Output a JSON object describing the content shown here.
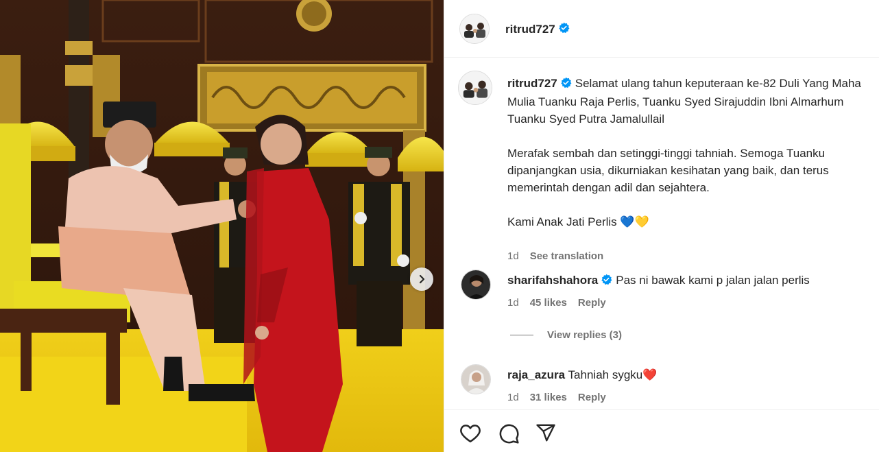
{
  "post": {
    "author": "ritrud727",
    "caption": {
      "username": "ritrud727",
      "paragraph1": "Selamat ulang tahun keputeraan ke-82 Duli Yang Maha Mulia Tuanku Raja Perlis, Tuanku Syed Sirajuddin Ibni Almarhum Tuanku Syed Putra Jamalullail",
      "paragraph2": "Merafak sembah dan setinggi-tinggi tahniah. Semoga Tuanku dipanjangkan usia, dikurniakan kesihatan yang baik, dan terus memerintah dengan adil dan sejahtera.",
      "paragraph3": "Kami Anak Jati Perlis 💙💛",
      "time": "1d",
      "see_translation": "See translation"
    },
    "comments": [
      {
        "username": "sharifahshahora",
        "text": "Pas ni bawak kami p jalan jalan perlis",
        "time": "1d",
        "likes": "45 likes",
        "reply": "Reply",
        "verified": true
      },
      {
        "username": "raja_azura",
        "text": "Tahniah sygku❤️",
        "time": "1d",
        "likes": "31 likes",
        "reply": "Reply",
        "verified": false
      }
    ],
    "view_replies": "View replies (3)"
  },
  "icons": {
    "verified": "verified-badge-icon",
    "next": "chevron-right-icon",
    "like": "heart-icon",
    "comment": "comment-icon",
    "share": "share-icon"
  },
  "colors": {
    "verified": "#0095f6",
    "muted": "#737373",
    "text": "#262626"
  }
}
